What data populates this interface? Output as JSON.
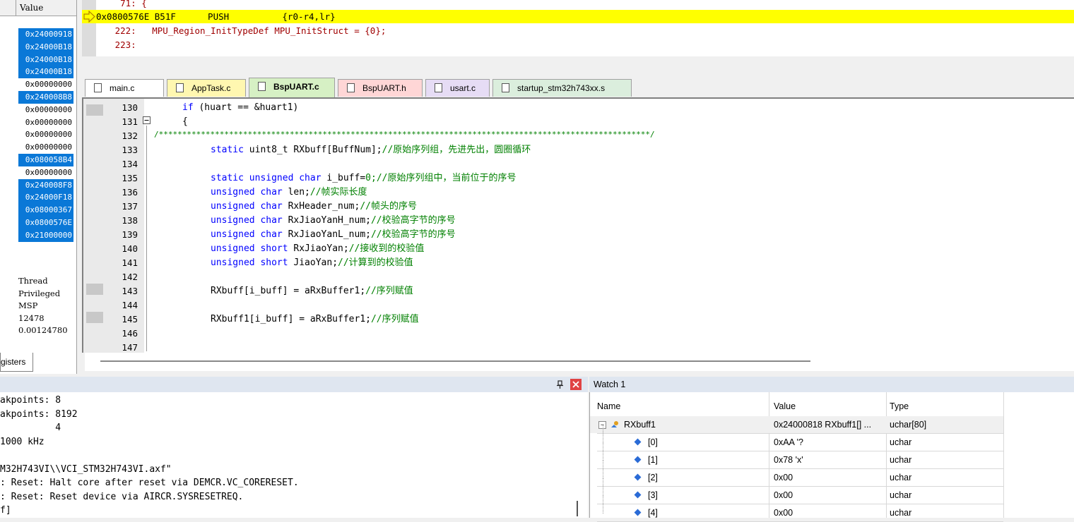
{
  "registers": {
    "header_value": "Value",
    "values": [
      "0x24000918",
      "0x24000B18",
      "0x24000B18",
      "0x24000B18",
      "0x00000000",
      "0x240008B8",
      "0x00000000",
      "0x00000000",
      "0x00000000",
      "0x00000000",
      "0x080058B4",
      "0x00000000",
      "0x240008F8",
      "0x24000F18",
      "0x08000367",
      "0x0800576E",
      "0x21000000"
    ],
    "selected": [
      true,
      true,
      true,
      true,
      false,
      true,
      false,
      false,
      false,
      false,
      true,
      false,
      true,
      true,
      true,
      true,
      true
    ],
    "status": [
      "Thread",
      "Privileged",
      "MSP",
      "12478",
      "0.00124780"
    ],
    "tab_label": "gisters"
  },
  "disassembly": {
    "lines": [
      "    71: {",
      "0x0800576E B51F      PUSH          {r0-r4,lr}",
      "   222:   MPU_Region_InitTypeDef MPU_InitStruct = {0};",
      "   223: "
    ]
  },
  "tabs": [
    {
      "label": "main.c",
      "color": "#ffffff",
      "active": false
    },
    {
      "label": "AppTask.c",
      "color": "#fff7b0",
      "active": false
    },
    {
      "label": "BspUART.c",
      "color": "#d6f0c4",
      "active": true
    },
    {
      "label": "BspUART.h",
      "color": "#ffd6d6",
      "active": false
    },
    {
      "label": "usart.c",
      "color": "#e6dcf5",
      "active": false
    },
    {
      "label": "startup_stm32h743xx.s",
      "color": "#dbeedd",
      "active": false
    }
  ],
  "editor": {
    "line_numbers": [
      "130",
      "131",
      "132",
      "133",
      "134",
      "135",
      "136",
      "137",
      "138",
      "139",
      "140",
      "141",
      "142",
      "143",
      "144",
      "145",
      "146",
      "147"
    ],
    "code": {
      "l130_a": "if",
      "l130_b": " (huart == &huart1)",
      "l131": "{",
      "l132": "/*********************************************************************************************************/",
      "l133_a": "static ",
      "l133_b": "uint8_t RXbuff[BuffNum];",
      "l133_c": "//原始序列组，先进先出，圆圈循环",
      "l135_a": "static unsigned char ",
      "l135_b": "i_buff=",
      "l135_n": "0",
      "l135_c": ";//原始序列组中，当前位于的序号",
      "l136_a": "unsigned char ",
      "l136_b": "len;",
      "l136_c": "//帧实际长度",
      "l137_a": "unsigned char ",
      "l137_b": "RxHeader_num;",
      "l137_c": "//帧头的序号",
      "l138_a": "unsigned char ",
      "l138_b": "RxJiaoYanH_num;",
      "l138_c": "//校验高字节的序号",
      "l139_a": "unsigned char ",
      "l139_b": "RxJiaoYanL_num;",
      "l139_c": "//校验高字节的序号",
      "l140_a": "unsigned short ",
      "l140_b": "RxJiaoYan;",
      "l140_c": "//接收到的校验值",
      "l141_a": "unsigned short ",
      "l141_b": "JiaoYan;",
      "l141_c": "//计算到的校验值",
      "l143_a": "RXbuff[i_buff] = aRxBuffer1;",
      "l143_c": "//序列赋值",
      "l145_a": "RXbuff1[i_buff] = aRxBuffer1;",
      "l145_c": "//序列赋值"
    }
  },
  "command_output": {
    "lines": [
      "akpoints: 8",
      "akpoints: 8192",
      "          4",
      "1000 kHz",
      "",
      "M32H743VI\\\\VCI_STM32H743VI.axf\"",
      ": Reset: Halt core after reset via DEMCR.VC_CORERESET.",
      ": Reset: Reset device via AIRCR.SYSRESETREQ.",
      "f]"
    ]
  },
  "watch": {
    "title": "Watch 1",
    "columns": [
      "Name",
      "Value",
      "Type"
    ],
    "rows": [
      {
        "name": "RXbuff1",
        "value": "0x24000818 RXbuff1[] ...",
        "type": "uchar[80]"
      },
      {
        "name": "[0]",
        "value": "0xAA '?",
        "type": "uchar"
      },
      {
        "name": "[1]",
        "value": "0x78 'x'",
        "type": "uchar"
      },
      {
        "name": "[2]",
        "value": "0x00",
        "type": "uchar"
      },
      {
        "name": "[3]",
        "value": "0x00",
        "type": "uchar"
      },
      {
        "name": "[4]",
        "value": "0x00",
        "type": "uchar"
      }
    ]
  }
}
